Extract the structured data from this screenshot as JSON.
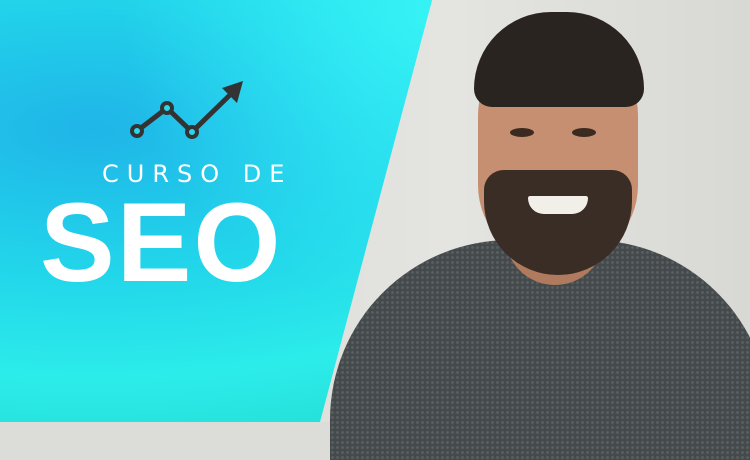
{
  "title": {
    "line1": "CURSO DE",
    "line2": "SEO"
  },
  "icon": "trending-up-chart-icon",
  "colors": {
    "accent": "#22d6ea",
    "text": "#ffffff",
    "icon": "#333333"
  }
}
